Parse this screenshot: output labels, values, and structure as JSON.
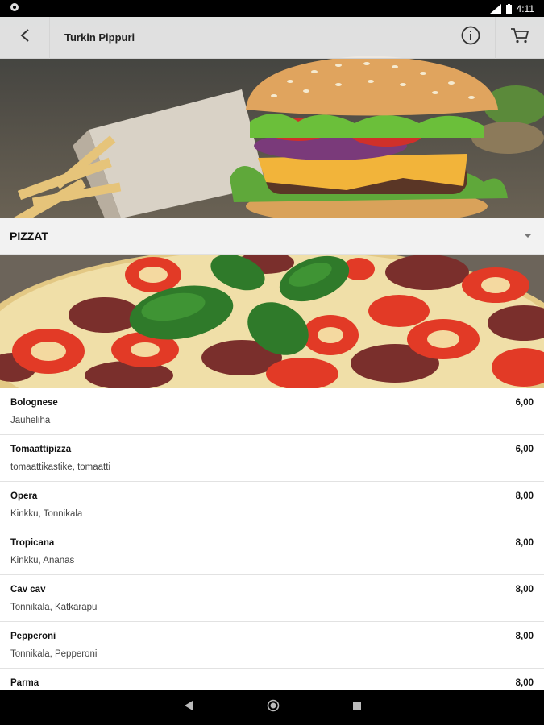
{
  "status_bar": {
    "time": "4:11"
  },
  "app_bar": {
    "title": "Turkin Pippuri"
  },
  "category": {
    "title": "PIZZAT"
  },
  "menu_items": [
    {
      "name": "Bolognese",
      "desc": "Jauheliha",
      "price": "6,00"
    },
    {
      "name": "Tomaattipizza",
      "desc": "tomaattikastike, tomaatti",
      "price": "6,00"
    },
    {
      "name": "Opera",
      "desc": "Kinkku, Tonnikala",
      "price": "8,00"
    },
    {
      "name": "Tropicana",
      "desc": "Kinkku, Ananas",
      "price": "8,00"
    },
    {
      "name": "Cav cav",
      "desc": "Tonnikala, Katkarapu",
      "price": "8,00"
    },
    {
      "name": "Pepperoni",
      "desc": "Tonnikala, Pepperoni",
      "price": "8,00"
    },
    {
      "name": "Parma",
      "desc": "",
      "price": "8,00"
    }
  ],
  "icons": {
    "back": "arrow-back-icon",
    "info": "info-icon",
    "cart": "cart-icon",
    "nav_back": "nav-back-icon",
    "nav_home": "nav-home-icon",
    "nav_recents": "nav-recents-icon"
  }
}
